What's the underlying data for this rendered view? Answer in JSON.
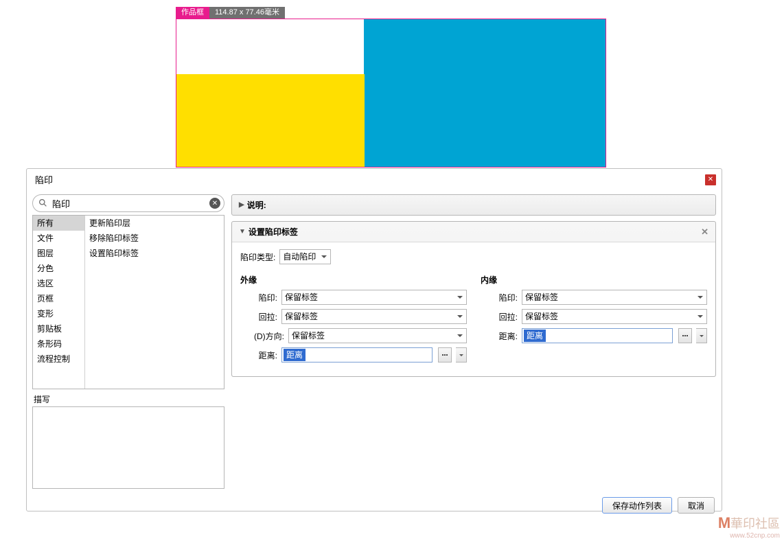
{
  "artwork": {
    "frame_label": "作品框",
    "dimensions": "114.87 x 77.46毫米"
  },
  "dialog": {
    "title": "陷印",
    "search_value": "陷印",
    "categories": [
      "所有",
      "文件",
      "图层",
      "分色",
      "选区",
      "页框",
      "变形",
      "剪贴板",
      "条形码",
      "流程控制"
    ],
    "selected_category_index": 0,
    "actions": [
      "更新陷印层",
      "移除陷印标签",
      "设置陷印标签"
    ],
    "desc_label": "描写",
    "section_desc_title": "说明:",
    "section_set_title": "设置陷印标签",
    "trap_type_label": "陷印类型:",
    "trap_type_value": "自动陷印",
    "outer_label": "外缘",
    "inner_label": "内缘",
    "field_trap": "陷印:",
    "field_pull": "回拉:",
    "field_direction": "(D)方向:",
    "field_distance": "距离:",
    "keep_tag": "保留标签",
    "distance_value": "距离",
    "save_button": "保存动作列表",
    "cancel_button": "取消"
  },
  "watermark": {
    "cn": "華印社區",
    "url": "www.52cnp.com"
  }
}
